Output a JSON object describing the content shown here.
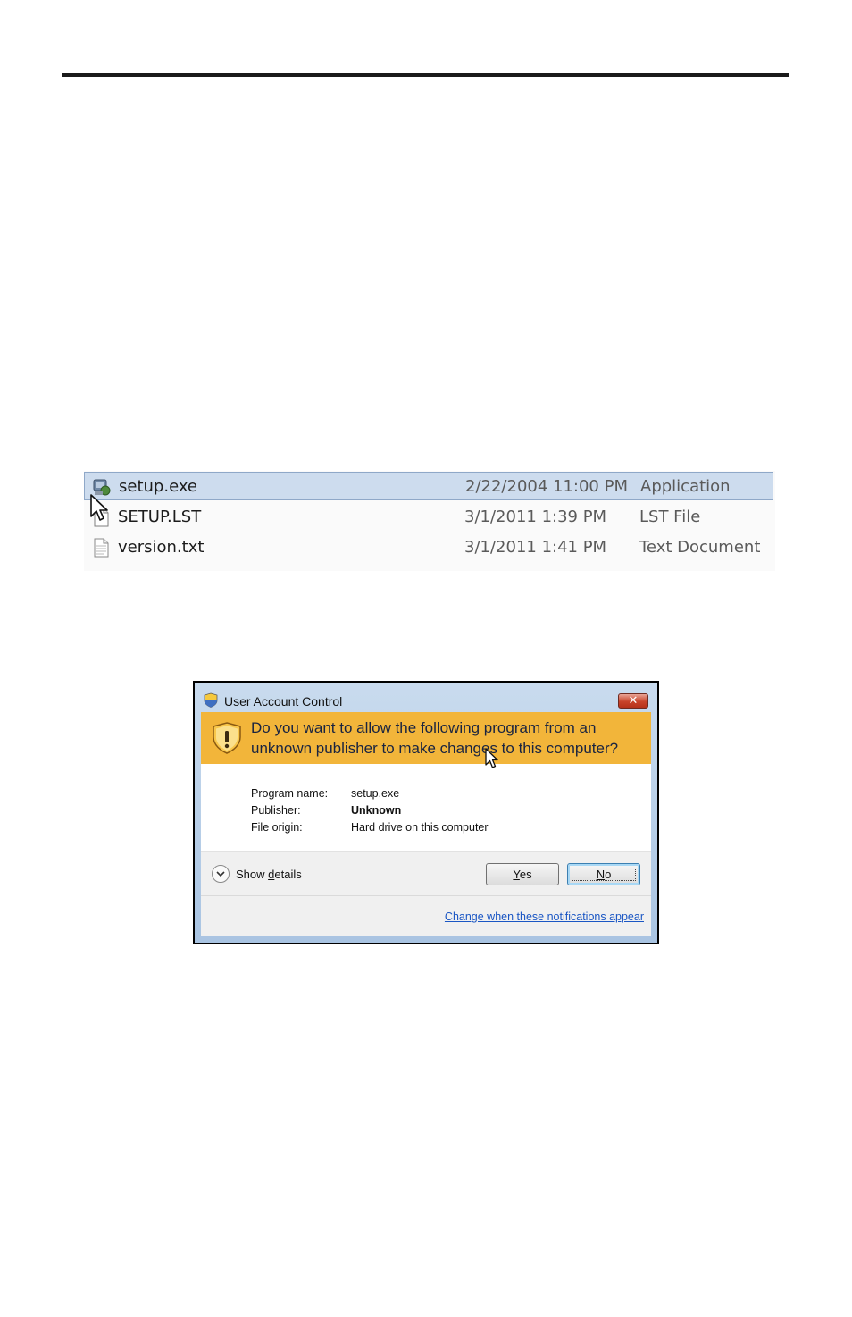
{
  "file_list": {
    "rows": [
      {
        "name": "setup.exe",
        "date": "2/22/2004 11:00 PM",
        "type": "Application",
        "icon": "setup-exe-icon",
        "selected": true
      },
      {
        "name": "SETUP.LST",
        "date": "3/1/2011 1:39 PM",
        "type": "LST File",
        "icon": "lst-file-icon",
        "selected": false
      },
      {
        "name": "version.txt",
        "date": "3/1/2011 1:41 PM",
        "type": "Text Document",
        "icon": "text-document-icon",
        "selected": false
      }
    ]
  },
  "uac": {
    "title": "User Account Control",
    "question": "Do you want to allow the following program from an unknown publisher to make changes to this computer?",
    "info": [
      {
        "label": "Program name:",
        "value": "setup.exe"
      },
      {
        "label": "Publisher:",
        "value": "Unknown"
      },
      {
        "label": "File origin:",
        "value": "Hard drive on this computer"
      }
    ],
    "show_details": {
      "pre": "Show ",
      "key": "d",
      "post": "etails"
    },
    "yes_button": {
      "key": "Y",
      "rest": "es"
    },
    "no_button": {
      "key": "N",
      "rest": "o"
    },
    "link": "Change when these notifications appear",
    "colors": {
      "banner": "#f2b53a",
      "link": "#1a56c4",
      "selection": "#cddcee"
    }
  }
}
